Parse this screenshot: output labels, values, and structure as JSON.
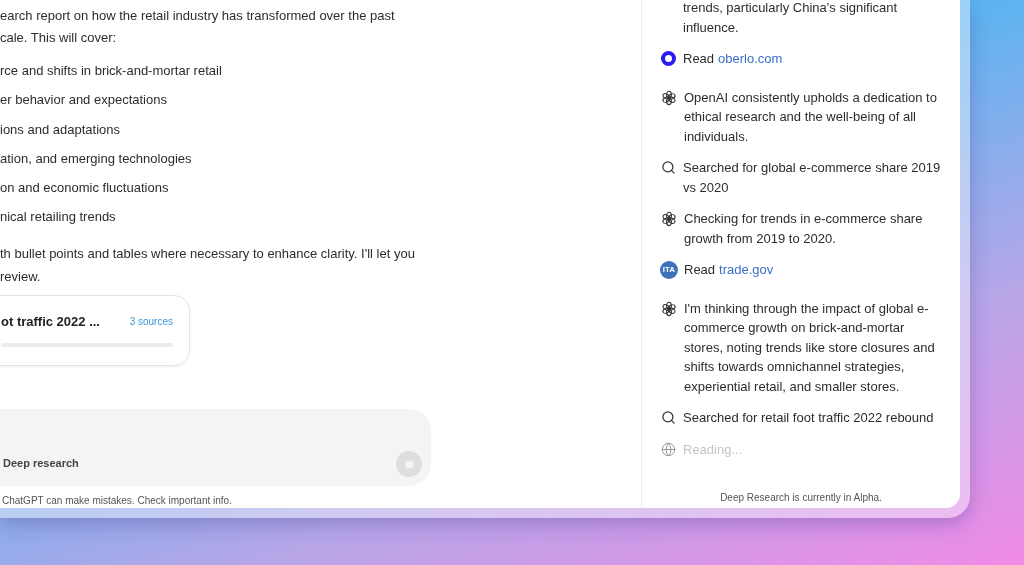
{
  "chat": {
    "intro_lines": [
      "earch report on how the retail industry has transformed over the past",
      "cale. This will cover:"
    ],
    "bullets": [
      "rce and shifts in brick-and-mortar retail",
      "er behavior and expectations",
      "ions and adaptations",
      "ation, and emerging technologies",
      "on and economic fluctuations",
      "nical retailing trends"
    ],
    "outro_lines": [
      "th bullet points and tables where necessary to enhance clarity. I'll let you",
      "review."
    ],
    "progress_card": {
      "title": "ot traffic 2022 ...",
      "sources": "3 sources"
    },
    "composer": {
      "mode": "Deep research"
    },
    "footer": "ChatGPT can make mistakes. Check important info."
  },
  "activity": {
    "items": [
      {
        "kind": "text",
        "text": "trends, particularly China's significant influence."
      },
      {
        "kind": "read",
        "label": "Read",
        "link": "oberlo.com"
      },
      {
        "kind": "think",
        "text": "OpenAI consistently upholds a dedication to ethical research and the well-being of all individuals."
      },
      {
        "kind": "search",
        "text": "Searched for global e-commerce share 2019 vs 2020"
      },
      {
        "kind": "think",
        "text": "Checking for trends in e-commerce share growth from 2019 to 2020."
      },
      {
        "kind": "read",
        "badge": "ITA",
        "label": "Read",
        "link": "trade.gov"
      },
      {
        "kind": "think",
        "text": "I'm thinking through the impact of global e-commerce growth on brick-and-mortar stores, noting trends like store closures and shifts towards omnichannel strategies, experiential retail, and smaller stores."
      },
      {
        "kind": "search",
        "text": "Searched for retail foot traffic 2022 rebound"
      },
      {
        "kind": "reading",
        "text": "Reading..."
      }
    ],
    "footer": "Deep Research is currently in Alpha."
  }
}
